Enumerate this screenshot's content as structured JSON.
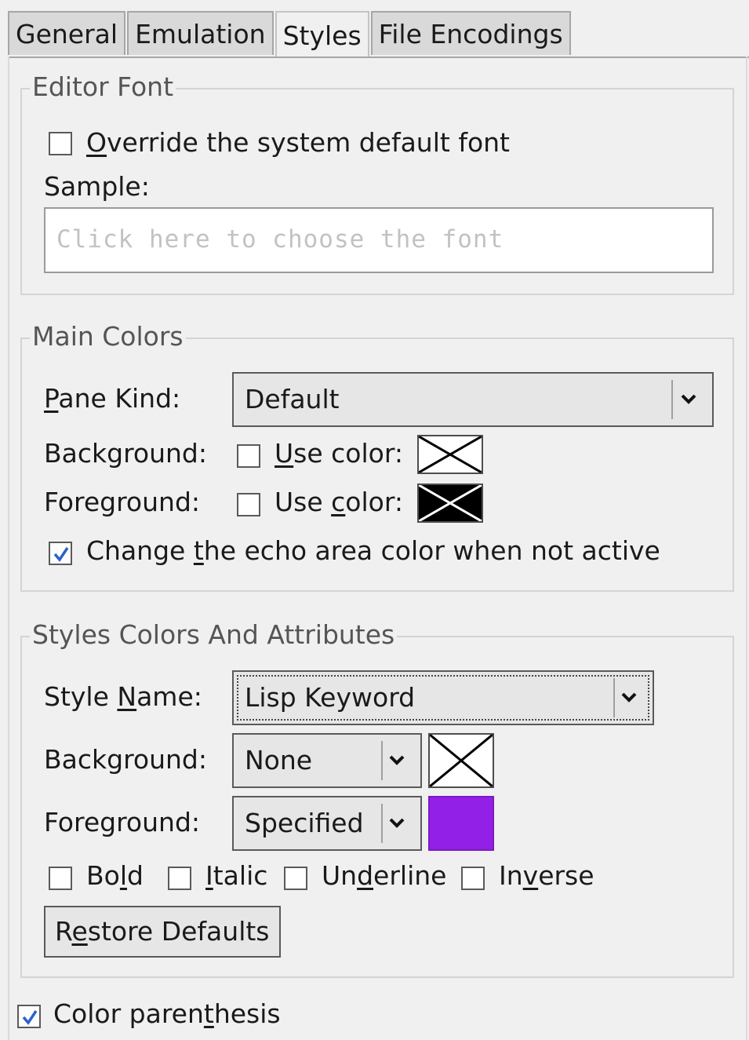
{
  "tabs": [
    {
      "label": "General",
      "active": false
    },
    {
      "label": "Emulation",
      "active": false
    },
    {
      "label": "Styles",
      "active": true
    },
    {
      "label": "File Encodings",
      "active": false
    }
  ],
  "editor_font": {
    "title": "Editor Font",
    "override_checkbox": {
      "mnemonic": "O",
      "rest": "verride the system default font",
      "checked": false
    },
    "sample_label": "Sample:",
    "sample_placeholder": "Click here to choose the font"
  },
  "main_colors": {
    "title": "Main Colors",
    "pane_kind": {
      "mnemonic": "P",
      "rest": "ane Kind:",
      "value": "Default"
    },
    "background": {
      "label": "Background:",
      "checkbox": {
        "before": "",
        "mnemonic": "U",
        "after": "se color:",
        "checked": false
      },
      "swatch_color": "#ffffff"
    },
    "foreground": {
      "label": "Foreground:",
      "checkbox": {
        "before": "Use ",
        "mnemonic": "c",
        "after": "olor:",
        "checked": false
      },
      "swatch_color": "#000000"
    },
    "echo_area": {
      "before": "Change ",
      "mnemonic": "t",
      "after": "he echo area color when not active",
      "checked": true
    }
  },
  "styles_colors": {
    "title": "Styles Colors And Attributes",
    "style_name": {
      "before": "Style ",
      "mnemonic": "N",
      "after": "ame:",
      "value": "Lisp Keyword"
    },
    "background": {
      "label": "Background:",
      "value": "None",
      "swatch_color": "none"
    },
    "foreground": {
      "label": "Foreground:",
      "value": "Specified",
      "swatch_color": "#9320e6"
    },
    "attributes": [
      {
        "before": "Bo",
        "mnemonic": "l",
        "after": "d",
        "checked": false
      },
      {
        "before": "",
        "mnemonic": "I",
        "after": "talic",
        "checked": false
      },
      {
        "before": "Un",
        "mnemonic": "d",
        "after": "erline",
        "checked": false
      },
      {
        "before": "In",
        "mnemonic": "v",
        "after": "erse",
        "checked": false
      }
    ],
    "restore_button": {
      "before": "R",
      "mnemonic": "e",
      "after": "store Defaults"
    }
  },
  "color_parenthesis": {
    "before": "Color paren",
    "mnemonic": "t",
    "after": "hesis",
    "checked": true
  },
  "colors": {
    "check_mark": "#2a62c9",
    "purple": "#9320e6"
  }
}
